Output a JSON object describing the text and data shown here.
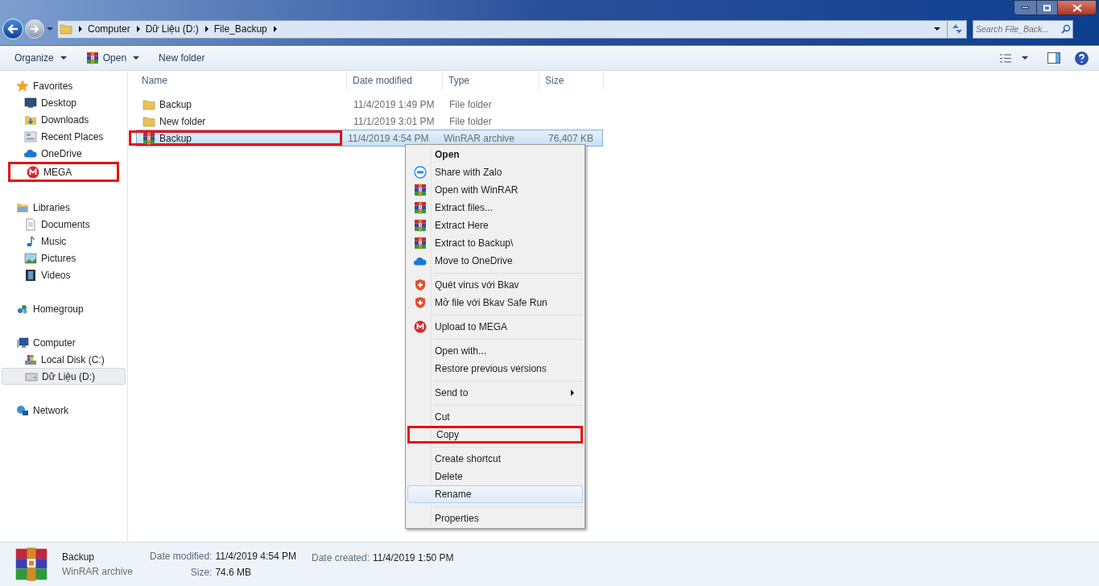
{
  "address": {
    "crumbs": [
      "Computer",
      "Dữ Liệu (D:)",
      "File_Backup"
    ]
  },
  "search": {
    "placeholder": "Search File_Back..."
  },
  "toolbar": {
    "buttons": [
      {
        "label": "Organize",
        "kind": "menu"
      },
      {
        "label": "Open",
        "kind": "winrar-menu"
      },
      {
        "label": "New folder",
        "kind": "plain"
      }
    ]
  },
  "sidebar": {
    "groups": [
      {
        "label": "Favorites",
        "kind": "star",
        "children": [
          {
            "label": "Desktop",
            "kind": "desktop",
            "selected": false,
            "highlighted": false
          },
          {
            "label": "Downloads",
            "kind": "downloads",
            "selected": false,
            "highlighted": false
          },
          {
            "label": "Recent Places",
            "kind": "recent",
            "selected": false,
            "highlighted": false
          },
          {
            "label": "OneDrive",
            "kind": "onedrive",
            "selected": false,
            "highlighted": false
          },
          {
            "label": "MEGA",
            "kind": "mega",
            "selected": false,
            "highlighted": true
          }
        ]
      },
      {
        "label": "Libraries",
        "kind": "library",
        "children": [
          {
            "label": "Documents",
            "kind": "document",
            "selected": false,
            "highlighted": false
          },
          {
            "label": "Music",
            "kind": "music",
            "selected": false,
            "highlighted": false
          },
          {
            "label": "Pictures",
            "kind": "pictures",
            "selected": false,
            "highlighted": false
          },
          {
            "label": "Videos",
            "kind": "videos",
            "selected": false,
            "highlighted": false
          }
        ]
      },
      {
        "label": "Homegroup",
        "kind": "homegroup"
      },
      {
        "label": "Computer",
        "kind": "computer",
        "children": [
          {
            "label": "Local Disk (C:)",
            "kind": "disk",
            "selected": false,
            "highlighted": false
          },
          {
            "label": "Dữ Liệu (D:)",
            "kind": "drive",
            "selected": true,
            "highlighted": false
          }
        ]
      },
      {
        "label": "Network",
        "kind": "network"
      }
    ]
  },
  "table": {
    "columns": [
      "Name",
      "Date modified",
      "Type",
      "Size"
    ],
    "rows": [
      {
        "kind": "folder",
        "name": "Backup",
        "date": "11/4/2019 1:49 PM",
        "type": "File folder",
        "selected": false,
        "highlighted": false
      },
      {
        "kind": "folder",
        "name": "New folder",
        "date": "11/1/2019 3:01 PM",
        "type": "File folder",
        "selected": false,
        "highlighted": false
      },
      {
        "kind": "winrar",
        "name": "Backup",
        "date": "11/4/2019 4:54 PM",
        "type": "WinRAR archive",
        "size": "76,407 KB",
        "selected": true,
        "highlighted": true
      }
    ]
  },
  "context_menu": {
    "groups": [
      [
        {
          "label": "Open",
          "kind": "none",
          "default": true,
          "submenu": false,
          "hover": false,
          "highlighted": false
        },
        {
          "label": "Share with Zalo",
          "kind": "zalo",
          "default": false,
          "submenu": false,
          "hover": false,
          "highlighted": false
        },
        {
          "label": "Open with WinRAR",
          "kind": "winrar",
          "default": false,
          "submenu": false,
          "hover": false,
          "highlighted": false
        },
        {
          "label": "Extract files...",
          "kind": "winrar",
          "default": false,
          "submenu": false,
          "hover": false,
          "highlighted": false
        },
        {
          "label": "Extract Here",
          "kind": "winrar",
          "default": false,
          "submenu": false,
          "hover": false,
          "highlighted": false
        },
        {
          "label": "Extract to Backup\\",
          "kind": "winrar",
          "default": false,
          "submenu": false,
          "hover": false,
          "highlighted": false
        },
        {
          "label": "Move to OneDrive",
          "kind": "onedrive",
          "default": false,
          "submenu": false,
          "hover": false,
          "highlighted": false
        }
      ],
      [
        {
          "label": "Quét virus với Bkav",
          "kind": "bkav",
          "default": false,
          "submenu": false,
          "hover": false,
          "highlighted": false
        },
        {
          "label": "Mở file với Bkav Safe Run",
          "kind": "bkav",
          "default": false,
          "submenu": false,
          "hover": false,
          "highlighted": false
        }
      ],
      [
        {
          "label": "Upload to MEGA",
          "kind": "mega",
          "default": false,
          "submenu": false,
          "hover": false,
          "highlighted": false
        }
      ],
      [
        {
          "label": "Open with...",
          "kind": "none",
          "default": false,
          "submenu": false,
          "hover": false,
          "highlighted": false
        },
        {
          "label": "Restore previous versions",
          "kind": "none",
          "default": false,
          "submenu": false,
          "hover": false,
          "highlighted": false
        }
      ],
      [
        {
          "label": "Send to",
          "kind": "none",
          "default": false,
          "submenu": true,
          "hover": false,
          "highlighted": false
        }
      ],
      [
        {
          "label": "Cut",
          "kind": "none",
          "default": false,
          "submenu": false,
          "hover": false,
          "highlighted": false
        },
        {
          "label": "Copy",
          "kind": "none",
          "default": false,
          "submenu": false,
          "hover": false,
          "highlighted": true
        }
      ],
      [
        {
          "label": "Create shortcut",
          "kind": "none",
          "default": false,
          "submenu": false,
          "hover": false,
          "highlighted": false
        },
        {
          "label": "Delete",
          "kind": "none",
          "default": false,
          "submenu": false,
          "hover": false,
          "highlighted": false
        },
        {
          "label": "Rename",
          "kind": "none",
          "default": false,
          "submenu": false,
          "hover": true,
          "highlighted": false
        }
      ],
      [
        {
          "label": "Properties",
          "kind": "none",
          "default": false,
          "submenu": false,
          "hover": false,
          "highlighted": false
        }
      ]
    ]
  },
  "details": {
    "name": "Backup",
    "type": "WinRAR archive",
    "fields": [
      {
        "label": "Date modified:",
        "value": "11/4/2019 4:54 PM"
      },
      {
        "label": "Date created:",
        "value": "11/4/2019 1:50 PM"
      },
      {
        "label": "Size:",
        "value": "74.6 MB"
      }
    ]
  }
}
